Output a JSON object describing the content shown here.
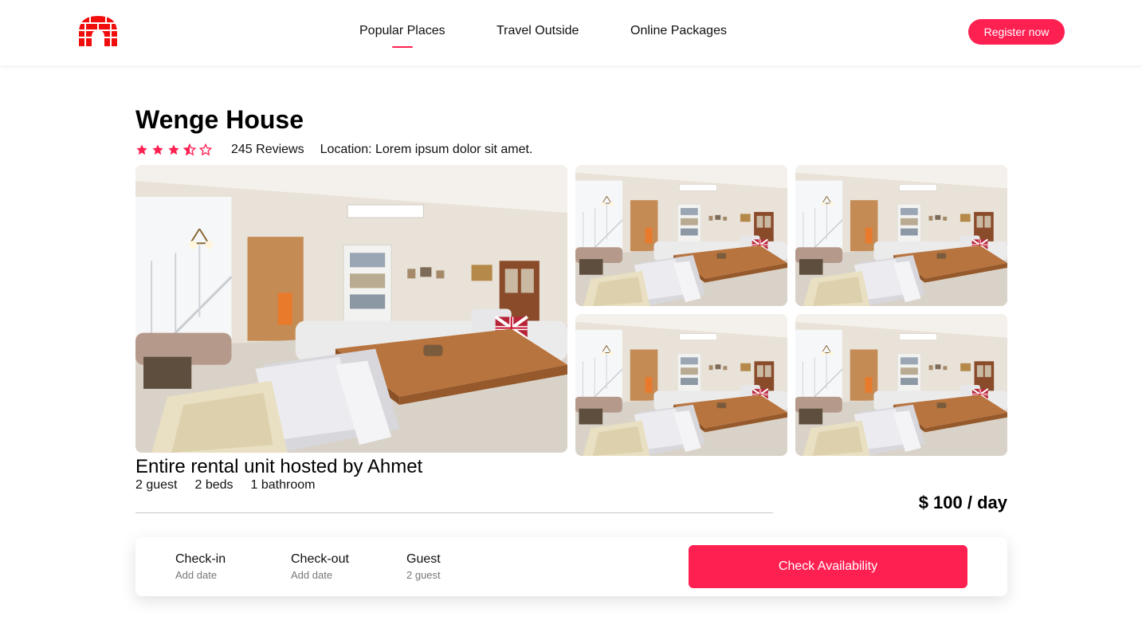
{
  "brand": {
    "logo_icon": "igloo-logo-icon",
    "accent_color": "#ff2052"
  },
  "nav": {
    "links": [
      {
        "label": "Popular Places",
        "active": true
      },
      {
        "label": "Travel Outside",
        "active": false
      },
      {
        "label": "Online Packages",
        "active": false
      }
    ],
    "register_label": "Register now"
  },
  "listing": {
    "title": "Wenge House",
    "rating": 3.5,
    "rating_max": 5,
    "reviews": "245 Reviews",
    "location": "Location: Lorem ipsum dolor sit amet.",
    "host_line": "Entire rental unit hosted by Ahmet",
    "specs": [
      "2 guest",
      "2 beds",
      "1 bathroom"
    ],
    "price": "$ 100 / day"
  },
  "booking": {
    "checkin_label": "Check-in",
    "checkin_value": "Add date",
    "checkout_label": "Check-out",
    "checkout_value": "Add date",
    "guest_label": "Guest",
    "guest_value": "2 guest",
    "button_label": "Check Availability"
  }
}
